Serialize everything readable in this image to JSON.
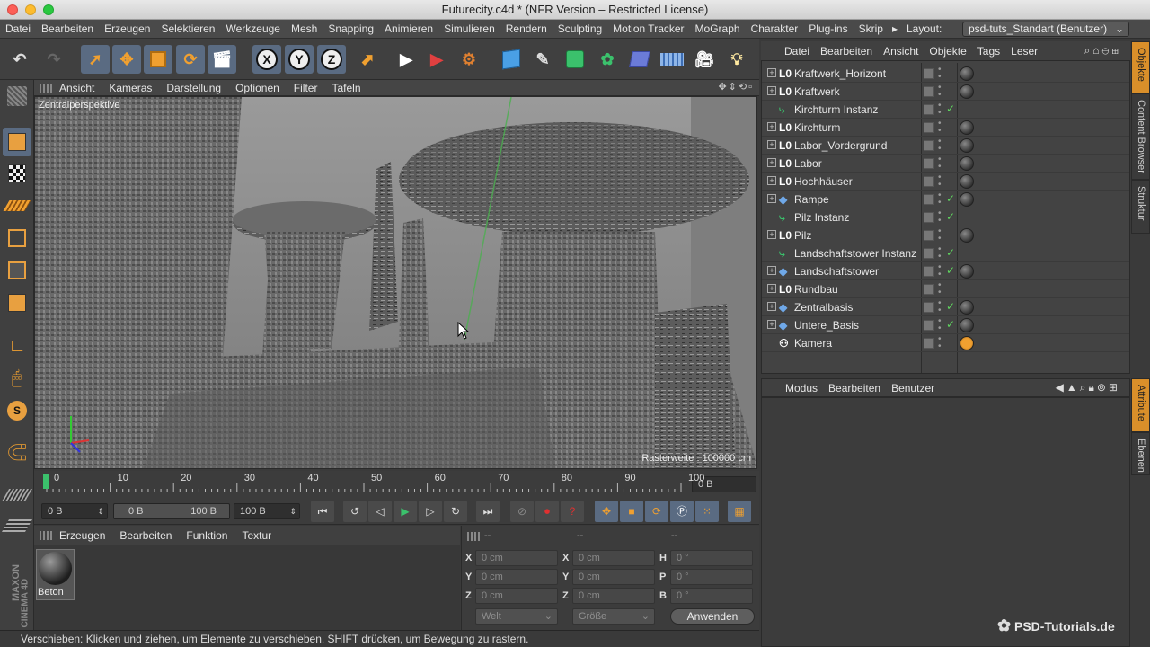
{
  "window": {
    "title": "Futurecity.c4d * (NFR Version – Restricted License)"
  },
  "menubar": {
    "items": [
      "Datei",
      "Bearbeiten",
      "Erzeugen",
      "Selektieren",
      "Werkzeuge",
      "Mesh",
      "Snapping",
      "Animieren",
      "Simulieren",
      "Rendern",
      "Sculpting",
      "Motion Tracker",
      "MoGraph",
      "Charakter",
      "Plug-ins",
      "Skrip"
    ],
    "layout_label": "Layout:",
    "layout_value": "psd-tuts_Standart (Benutzer)"
  },
  "toolbar": {
    "axis_x": "X",
    "axis_y": "Y",
    "axis_z": "Z"
  },
  "viewport": {
    "menu": [
      "Ansicht",
      "Kameras",
      "Darstellung",
      "Optionen",
      "Filter",
      "Tafeln"
    ],
    "perspective_label": "Zentralperspektive",
    "grid_info": "Rasterweite : 100000 cm"
  },
  "timeline": {
    "ticks": [
      "0",
      "10",
      "20",
      "30",
      "40",
      "50",
      "60",
      "70",
      "80",
      "90",
      "100"
    ],
    "current_frame": "0 B",
    "start_field": "0 B",
    "range_min": "0 B",
    "range_max": "100 B",
    "end_field": "100 B"
  },
  "material_manager": {
    "menu": [
      "Erzeugen",
      "Bearbeiten",
      "Funktion",
      "Textur"
    ],
    "materials": [
      {
        "name": "Beton"
      }
    ]
  },
  "coordinates": {
    "headers": [
      "--",
      "--",
      "--"
    ],
    "rows": [
      {
        "l1": "X",
        "v1": "0 cm",
        "l2": "X",
        "v2": "0 cm",
        "l3": "H",
        "v3": "0 °"
      },
      {
        "l1": "Y",
        "v1": "0 cm",
        "l2": "Y",
        "v2": "0 cm",
        "l3": "P",
        "v3": "0 °"
      },
      {
        "l1": "Z",
        "v1": "0 cm",
        "l2": "Z",
        "v2": "0 cm",
        "l3": "B",
        "v3": "0 °"
      }
    ],
    "mode_select": "Welt",
    "size_select": "Größe",
    "apply_button": "Anwenden"
  },
  "statusbar": {
    "text": "Verschieben: Klicken und ziehen, um Elemente zu verschieben. SHIFT drücken, um Bewegung zu rastern."
  },
  "object_manager": {
    "menu": [
      "Datei",
      "Bearbeiten",
      "Ansicht",
      "Objekte",
      "Tags",
      "Leser"
    ],
    "objects": [
      {
        "name": "Kraftwerk_Horizont",
        "icon": "L0",
        "check": false,
        "tag": true
      },
      {
        "name": "Kraftwerk",
        "icon": "L0",
        "check": false,
        "tag": true
      },
      {
        "name": "Kirchturm Instanz",
        "icon": "instance",
        "check": true,
        "tag": false
      },
      {
        "name": "Kirchturm",
        "icon": "L0",
        "check": false,
        "tag": true
      },
      {
        "name": "Labor_Vordergrund",
        "icon": "L0",
        "check": false,
        "tag": true
      },
      {
        "name": "Labor",
        "icon": "L0",
        "check": false,
        "tag": true
      },
      {
        "name": "Hochhäuser",
        "icon": "L0",
        "check": false,
        "tag": true
      },
      {
        "name": "Rampe",
        "icon": "poly",
        "check": true,
        "tag": true
      },
      {
        "name": "Pilz Instanz",
        "icon": "instance",
        "check": true,
        "tag": false
      },
      {
        "name": "Pilz",
        "icon": "L0",
        "check": false,
        "tag": true
      },
      {
        "name": "Landschaftstower Instanz",
        "icon": "instance",
        "check": true,
        "tag": false
      },
      {
        "name": "Landschaftstower",
        "icon": "poly",
        "check": true,
        "tag": true
      },
      {
        "name": "Rundbau",
        "icon": "L0",
        "check": false,
        "tag": false
      },
      {
        "name": "Zentralbasis",
        "icon": "poly",
        "check": true,
        "tag": true
      },
      {
        "name": "Untere_Basis",
        "icon": "poly",
        "check": true,
        "tag": true
      },
      {
        "name": "Kamera",
        "icon": "camera",
        "check": false,
        "tag": false
      }
    ]
  },
  "attribute_manager": {
    "menu": [
      "Modus",
      "Bearbeiten",
      "Benutzer"
    ]
  },
  "side_tabs": {
    "objekte": "Objekte",
    "content_browser": "Content Browser",
    "struktur": "Struktur",
    "attribute": "Attribute",
    "ebenen": "Ebenen"
  },
  "branding": {
    "maxon": "MAXON",
    "cinema": "CINEMA 4D",
    "watermark": "PSD-Tutorials.de"
  }
}
